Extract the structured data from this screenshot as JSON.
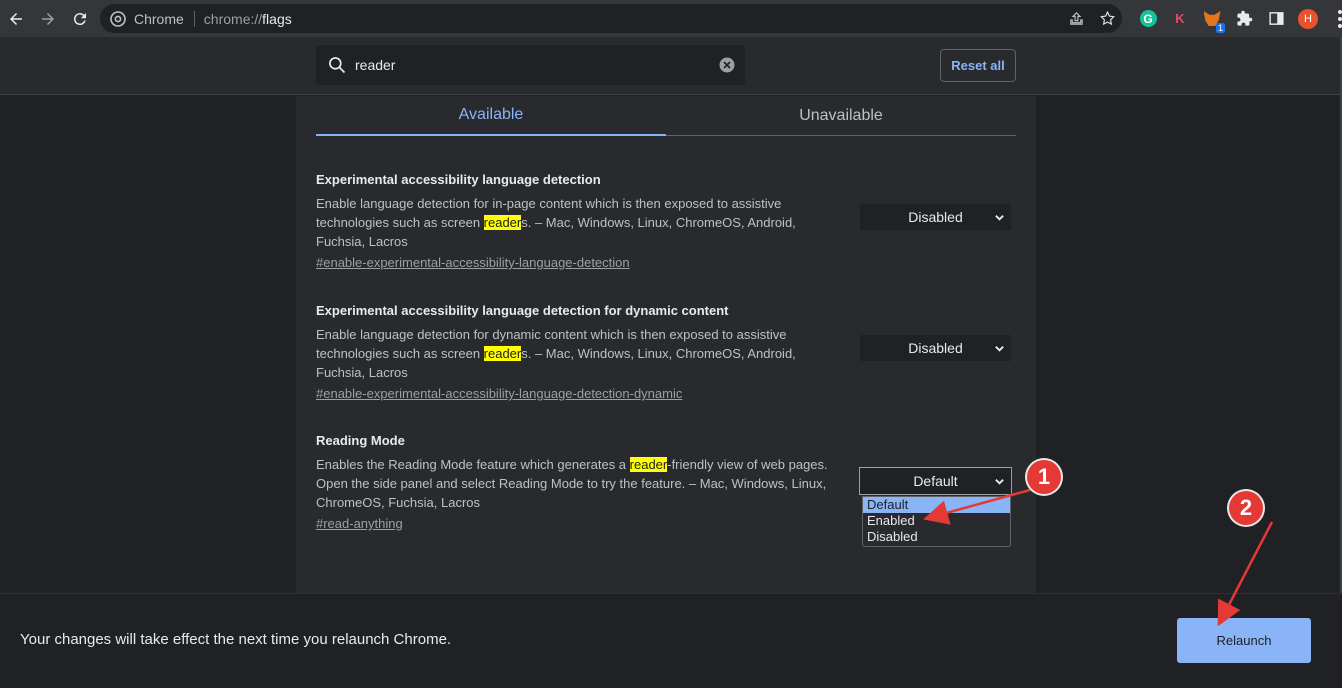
{
  "browser": {
    "site_name": "Chrome",
    "url_prefix": "chrome://",
    "url_path": "flags",
    "avatar_initial": "H",
    "extensions": [
      {
        "name": "grammarly-icon",
        "label": "G"
      },
      {
        "name": "k-extension-icon",
        "label": "K"
      },
      {
        "name": "metamask-icon",
        "badge": "1"
      }
    ]
  },
  "flags_header": {
    "search_value": "reader",
    "reset_label": "Reset all"
  },
  "tabs": [
    {
      "label": "Available",
      "active": true
    },
    {
      "label": "Unavailable",
      "active": false
    }
  ],
  "flags": [
    {
      "title": "Experimental accessibility language detection",
      "desc_before": "Enable language detection for in-page content which is then exposed to assistive technologies such as screen ",
      "highlight": "reader",
      "desc_after": "s. – Mac, Windows, Linux, ChromeOS, Android, Fuchsia, Lacros",
      "link": "#enable-experimental-accessibility-language-detection",
      "value": "Disabled"
    },
    {
      "title": "Experimental accessibility language detection for dynamic content",
      "desc_before": "Enable language detection for dynamic content which is then exposed to assistive technologies such as screen ",
      "highlight": "reader",
      "desc_after": "s. – Mac, Windows, Linux, ChromeOS, Android, Fuchsia, Lacros",
      "link": "#enable-experimental-accessibility-language-detection-dynamic",
      "value": "Disabled"
    },
    {
      "title": "Reading Mode",
      "desc_before": "Enables the Reading Mode feature which generates a ",
      "highlight": "reader",
      "desc_after": "-friendly view of web pages. Open the side panel and select Reading Mode to try the feature. – Mac, Windows, Linux, ChromeOS, Fuchsia, Lacros",
      "link": "#read-anything",
      "value": "Default"
    }
  ],
  "dropdown_options": [
    "Default",
    "Enabled",
    "Disabled"
  ],
  "relaunch": {
    "message": "Your changes will take effect the next time you relaunch Chrome.",
    "button_label": "Relaunch"
  },
  "annotations": [
    {
      "number": "1"
    },
    {
      "number": "2"
    }
  ],
  "colors": {
    "accent": "#8ab4f8",
    "highlight": "#ffff00",
    "callout": "#e53935"
  }
}
